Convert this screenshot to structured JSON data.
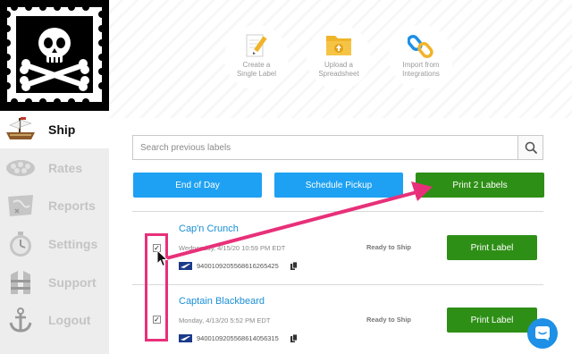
{
  "sidebar": {
    "items": [
      {
        "label": "Ship",
        "icon": "pirate-ship-icon"
      },
      {
        "label": "Rates",
        "icon": "rates-icon"
      },
      {
        "label": "Reports",
        "icon": "map-icon"
      },
      {
        "label": "Settings",
        "icon": "stopwatch-icon"
      },
      {
        "label": "Support",
        "icon": "life-vest-icon"
      },
      {
        "label": "Logout",
        "icon": "anchor-icon"
      }
    ]
  },
  "actions": [
    {
      "label_line1": "Create a",
      "label_line2": "Single Label",
      "icon": "pencil-label-icon"
    },
    {
      "label_line1": "Upload a",
      "label_line2": "Spreadsheet",
      "icon": "folder-upload-icon"
    },
    {
      "label_line1": "Import from",
      "label_line2": "Integrations",
      "icon": "chain-link-icon"
    }
  ],
  "search": {
    "placeholder": "Search previous labels"
  },
  "toolbar": {
    "end_of_day": "End of Day",
    "schedule_pickup": "Schedule Pickup",
    "print_labels": "Print 2 Labels"
  },
  "labels": [
    {
      "name": "Cap'n Crunch",
      "date": "Wednesday, 4/15/20 10:59 PM EDT",
      "tracking": "9400109205568616265425",
      "status": "Ready to Ship",
      "button": "Print Label",
      "checked": true
    },
    {
      "name": "Captain Blackbeard",
      "date": "Monday, 4/13/20 5:52 PM EDT",
      "tracking": "9400109205568614056315",
      "status": "Ready to Ship",
      "button": "Print Label",
      "checked": true
    }
  ],
  "colors": {
    "primary_blue": "#1ea1f2",
    "primary_green": "#2e8f16",
    "annotation_pink": "#e8307a",
    "link_blue": "#1a8fd6"
  }
}
